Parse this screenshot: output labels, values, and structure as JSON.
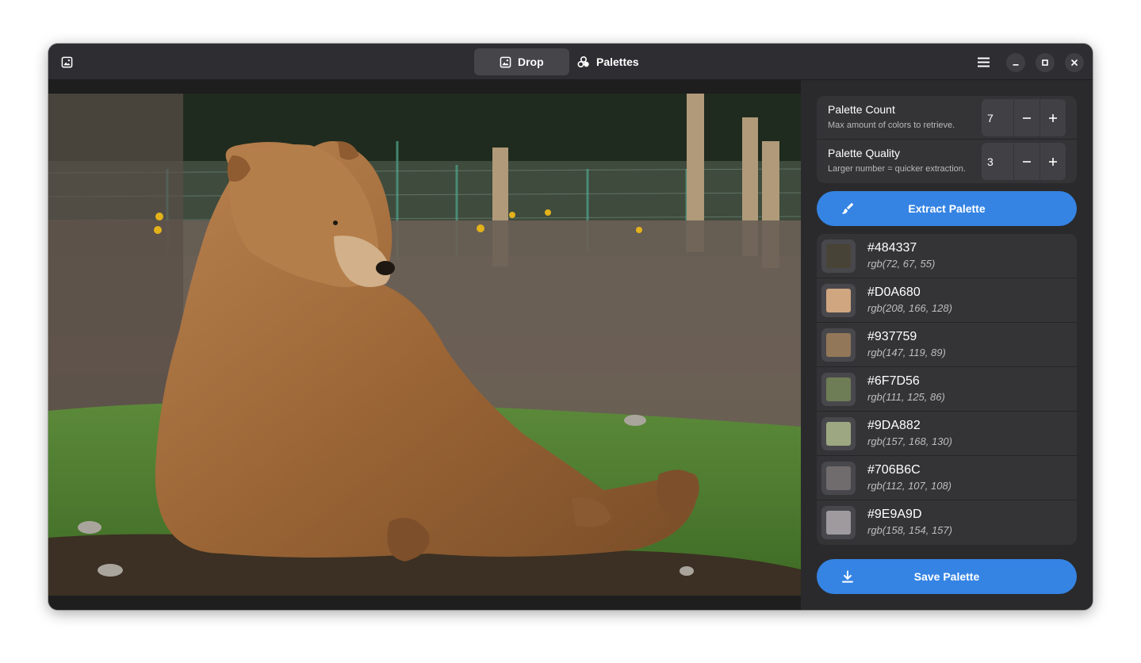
{
  "header": {
    "tabs": [
      {
        "label": "Drop",
        "icon": "image-icon",
        "active": true
      },
      {
        "label": "Palettes",
        "icon": "palettes-icon",
        "active": false
      }
    ]
  },
  "settings": {
    "count": {
      "title": "Palette Count",
      "subtitle": "Max amount of colors to retrieve.",
      "value": "7"
    },
    "quality": {
      "title": "Palette Quality",
      "subtitle": "Larger number = quicker extraction.",
      "value": "3"
    }
  },
  "actions": {
    "extract_label": "Extract Palette",
    "save_label": "Save Palette"
  },
  "palette": [
    {
      "hex": "#484337",
      "rgb": "rgb(72, 67, 55)",
      "color": "#484337"
    },
    {
      "hex": "#D0A680",
      "rgb": "rgb(208, 166, 128)",
      "color": "#D0A680"
    },
    {
      "hex": "#937759",
      "rgb": "rgb(147, 119, 89)",
      "color": "#937759"
    },
    {
      "hex": "#6F7D56",
      "rgb": "rgb(111, 125, 86)",
      "color": "#6F7D56"
    },
    {
      "hex": "#9DA882",
      "rgb": "rgb(157, 168, 130)",
      "color": "#9DA882"
    },
    {
      "hex": "#706B6C",
      "rgb": "rgb(112, 107, 108)",
      "color": "#706B6C"
    },
    {
      "hex": "#9E9A9D",
      "rgb": "rgb(158, 154, 157)",
      "color": "#9E9A9D"
    }
  ],
  "colors": {
    "accent": "#3584e4",
    "window": "#242424",
    "headerbar": "#2e2e32",
    "card": "#343437"
  }
}
